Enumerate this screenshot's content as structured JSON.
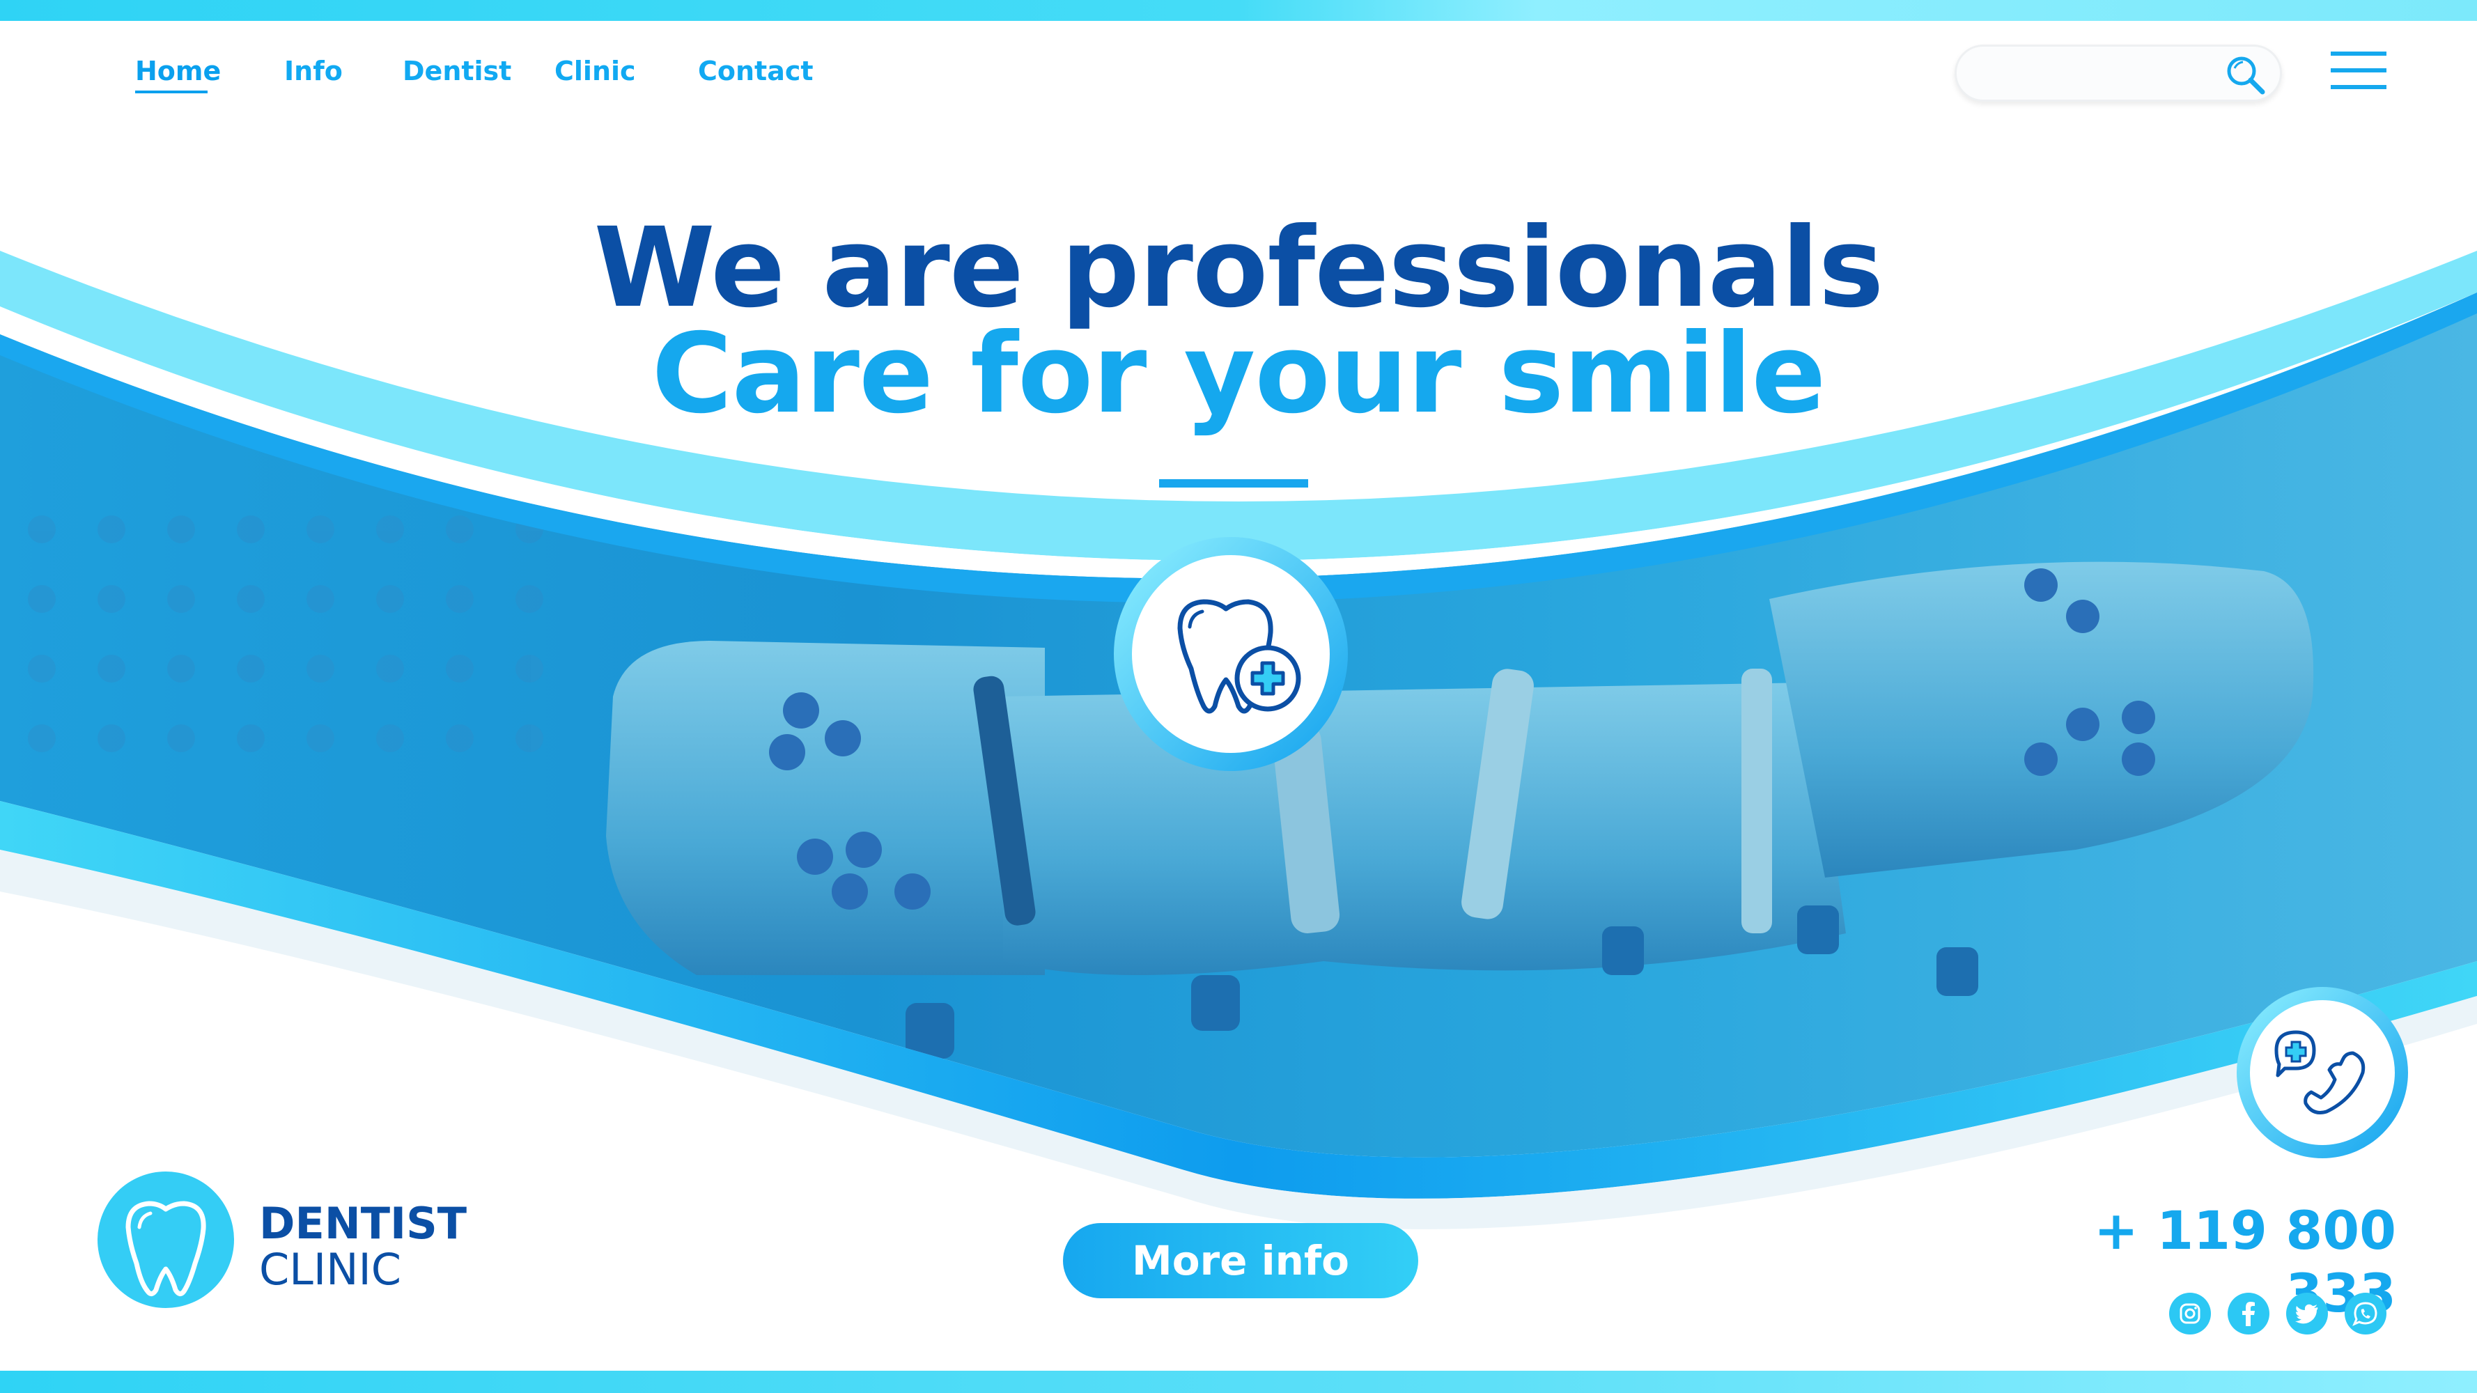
{
  "nav": {
    "items": [
      {
        "label": "Home",
        "active": true
      },
      {
        "label": "Info",
        "active": false
      },
      {
        "label": "Dentist",
        "active": false
      },
      {
        "label": "Clinic",
        "active": false
      },
      {
        "label": "Contact",
        "active": false
      }
    ]
  },
  "search": {
    "value": "",
    "icon": "search-icon"
  },
  "menu": {
    "icon": "hamburger-menu-icon"
  },
  "hero": {
    "headline_line_1": "We are professionals",
    "headline_line_2": "Care for your smile",
    "center_badge_icon": "tooth-plus-icon",
    "image_subject": "dental-equipment-photo"
  },
  "call_badge": {
    "icon": "phone-medical-icon"
  },
  "logo": {
    "icon": "tooth-icon",
    "line_1": "DENTIST",
    "line_2": "CLINIC"
  },
  "cta": {
    "label": "More info"
  },
  "contact": {
    "phone": "+ 119 800 333",
    "social": [
      "instagram-icon",
      "facebook-icon",
      "twitter-icon",
      "whatsapp-icon"
    ]
  },
  "colors": {
    "navy": "#0b4fa5",
    "primary_blue": "#15a8ee",
    "cyan": "#34cdf5",
    "light_cyan": "#8fefff",
    "white": "#ffffff"
  }
}
